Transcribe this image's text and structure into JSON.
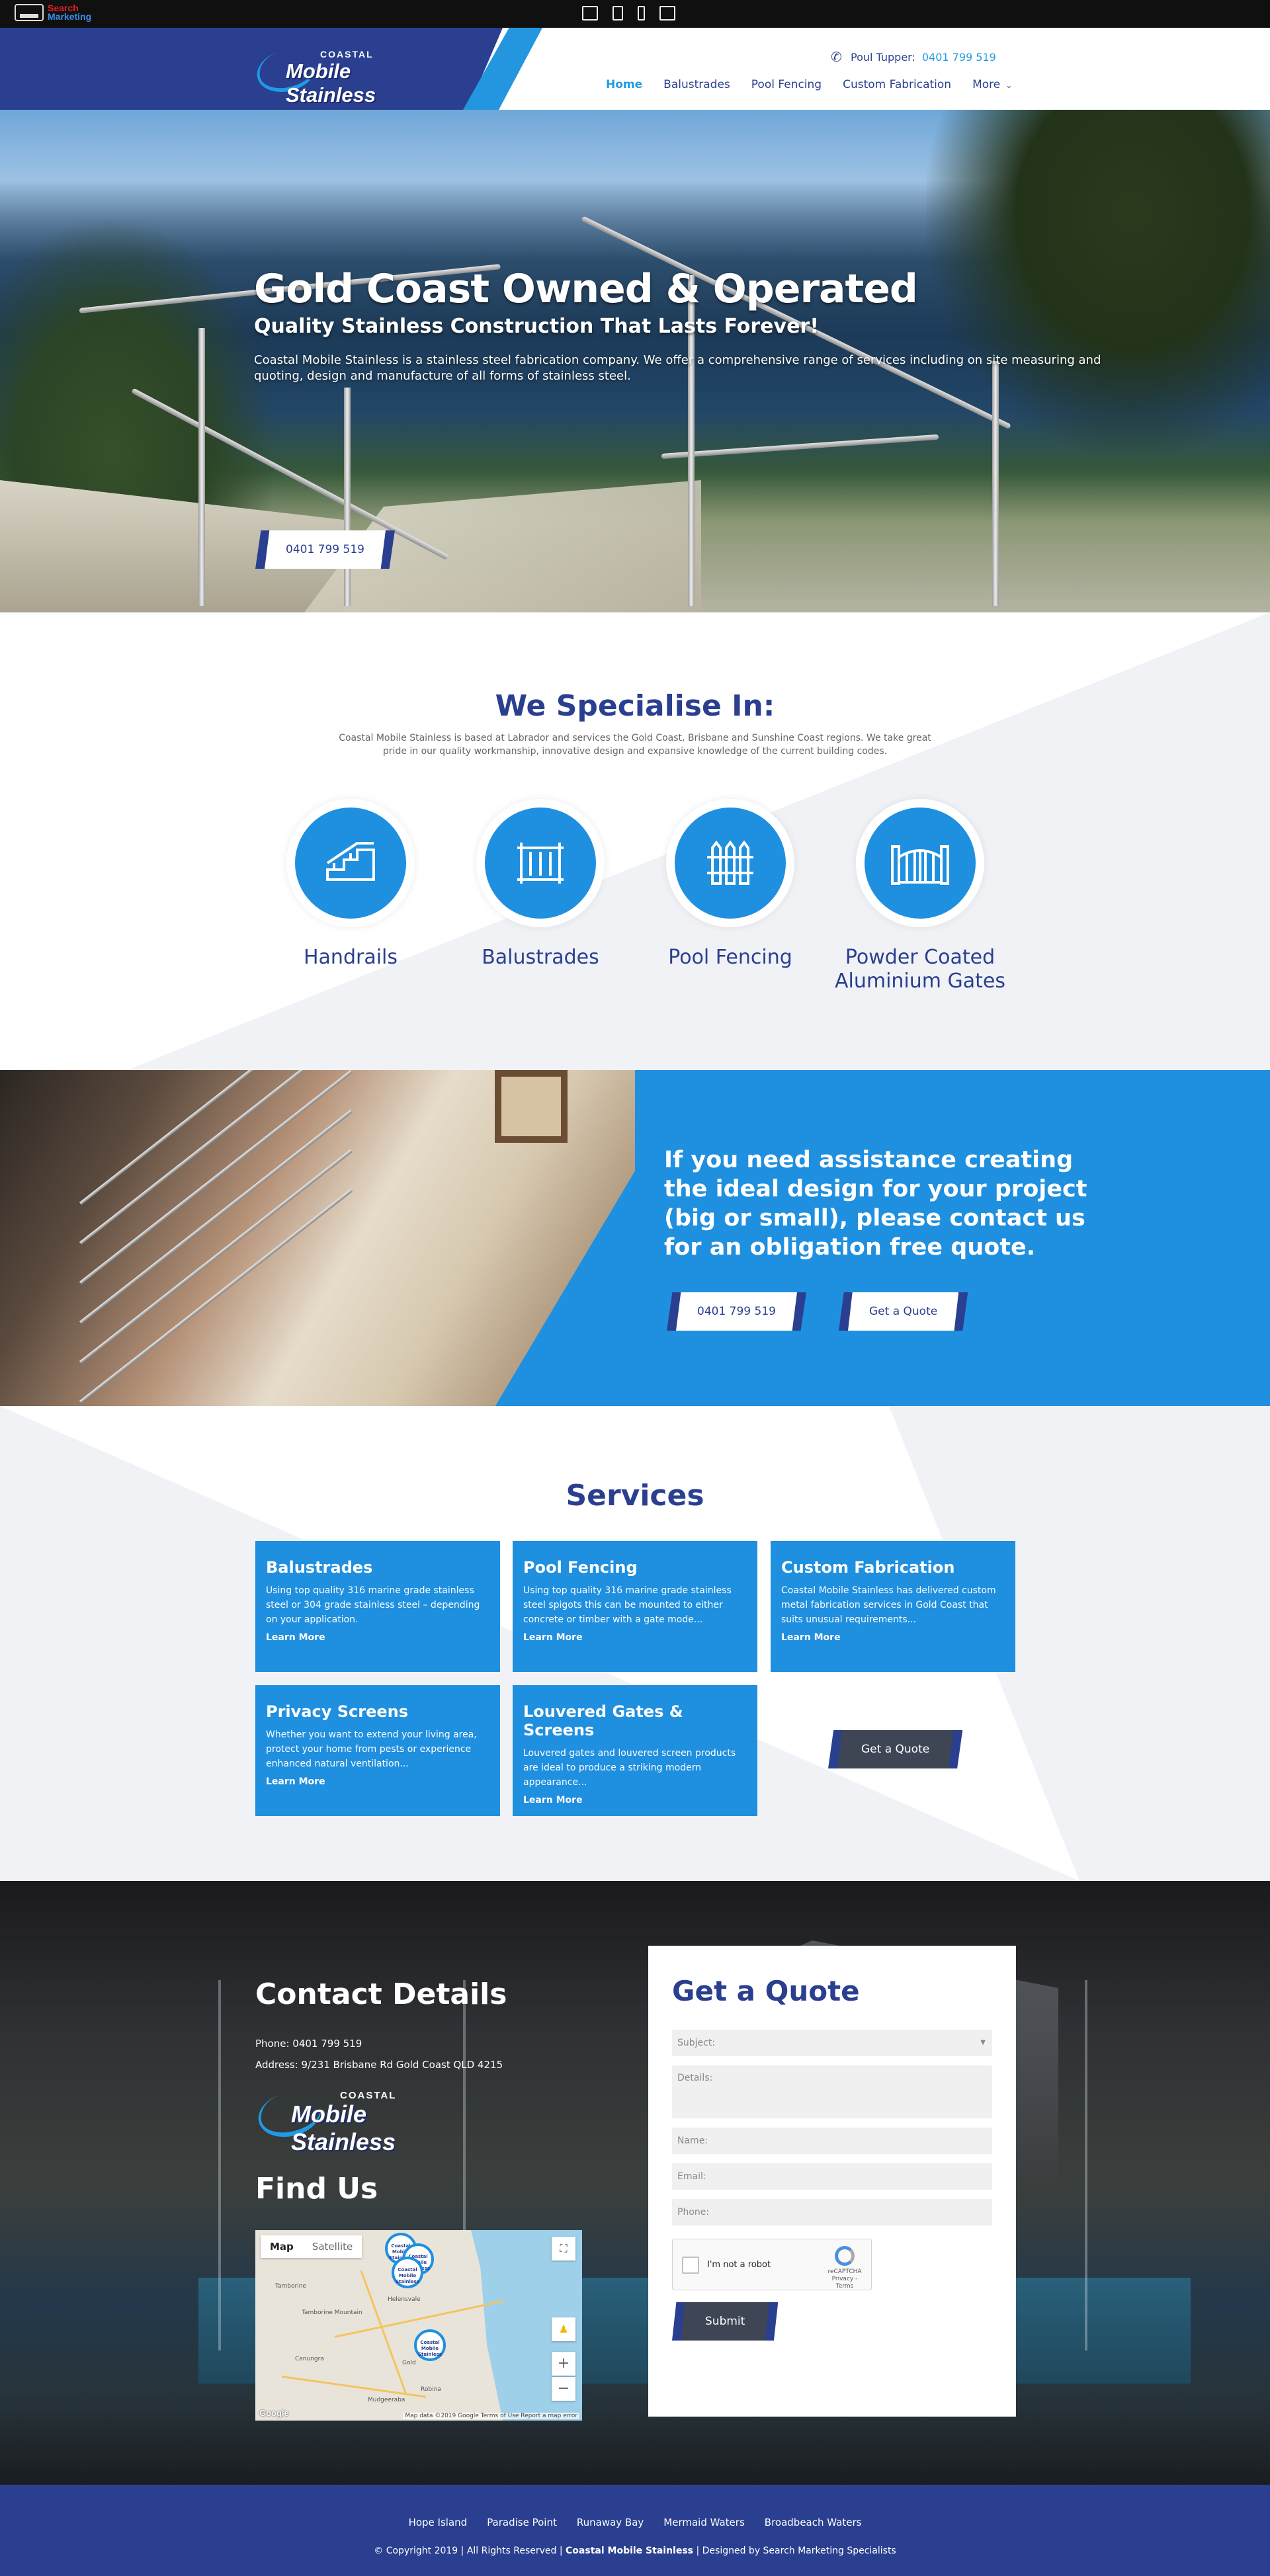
{
  "toolbar": {
    "brand_line1": "Search",
    "brand_line2": "Marketing",
    "devices": [
      "desktop-icon",
      "tablet-icon",
      "phone-icon",
      "responsive-icon"
    ]
  },
  "header": {
    "logo_top": "COASTAL",
    "logo_main": "Mobile Stainless",
    "phone_label": "Poul Tupper:",
    "phone_number": "0401 799 519",
    "nav": [
      {
        "label": "Home",
        "active": true
      },
      {
        "label": "Balustrades"
      },
      {
        "label": "Pool Fencing"
      },
      {
        "label": "Custom Fabrication"
      },
      {
        "label": "More"
      }
    ]
  },
  "hero": {
    "title": "Gold Coast Owned & Operated",
    "subtitle": "Quality Stainless Construction That Lasts Forever!",
    "body": "Coastal Mobile Stainless is a stainless steel fabrication company. We offer a comprehensive range of services including on site measuring and quoting, design and manufacture of all forms of stainless steel.",
    "button": "0401 799 519"
  },
  "specialise": {
    "title": "We Specialise In:",
    "body": "Coastal Mobile Stainless is based at Labrador and services the Gold Coast, Brisbane and Sunshine Coast regions. We take great pride in our quality workmanship, innovative design and expansive knowledge of the current building codes.",
    "items": [
      {
        "label": "Handrails",
        "icon": "handrail-icon"
      },
      {
        "label": "Balustrades",
        "icon": "balustrade-icon"
      },
      {
        "label": "Pool Fencing",
        "icon": "pool-fence-icon"
      },
      {
        "label": "Powder Coated Aluminium Gates",
        "icon": "gate-icon"
      }
    ]
  },
  "cta": {
    "text": "If you need assistance creating the ideal design for your project (big or small), please contact us for an obligation free quote.",
    "phone_button": "0401 799 519",
    "quote_button": "Get a Quote"
  },
  "services": {
    "title": "Services",
    "cards": [
      {
        "title": "Balustrades",
        "body": "Using top quality 316 marine grade stainless steel or 304 grade stainless steel – depending on your application.",
        "link": "Learn More"
      },
      {
        "title": "Pool Fencing",
        "body": "Using top quality 316 marine grade stainless steel spigots this can be mounted to either concrete or timber with a gate mode...",
        "link": "Learn More"
      },
      {
        "title": "Custom Fabrication",
        "body": "Coastal Mobile Stainless has delivered custom metal fabrication services in Gold Coast that suits unusual requirements...",
        "link": "Learn More"
      },
      {
        "title": "Privacy Screens",
        "body": "Whether you want to extend your living area, protect your home from pests or experience enhanced natural ventilation...",
        "link": "Learn More"
      },
      {
        "title": "Louvered Gates & Screens",
        "body": "Louvered gates and louvered screen products are ideal to produce a striking modern appearance...",
        "link": "Learn More"
      }
    ],
    "quote_button": "Get a Quote"
  },
  "contact": {
    "title": "Contact Details",
    "phone": "Phone: 0401 799 519",
    "address": "Address: 9/231 Brisbane Rd Gold Coast QLD 4215",
    "logo_top": "COASTAL",
    "logo_main": "Mobile Stainless",
    "find_us": "Find Us",
    "map": {
      "tab_map": "Map",
      "tab_satellite": "Satellite",
      "google": "Google",
      "attribution": "Map data ©2019 Google   Terms of Use   Report a map error",
      "pin_label": "Coastal Mobile Stainless",
      "towns": [
        "Tamborine",
        "Tamborine Mountain",
        "Canungra",
        "Helensvale",
        "Gold",
        "Robina",
        "Mudgeeraba"
      ]
    }
  },
  "quote_form": {
    "title": "Get a Quote",
    "subject": "Subject:",
    "details": "Details:",
    "name": "Name:",
    "email": "Email:",
    "phone": "Phone:",
    "captcha_label": "I'm not a robot",
    "captcha_brand": "reCAPTCHA",
    "captcha_links": "Privacy - Terms",
    "submit": "Submit"
  },
  "footer": {
    "links": [
      "Hope Island",
      "Paradise Point",
      "Runaway Bay",
      "Mermaid Waters",
      "Broadbeach Waters"
    ],
    "copy_prefix": "© Copyright 2019 | All Rights Reserved |",
    "copy_brand": "Coastal Mobile Stainless",
    "copy_suffix": "| Designed by Search Marketing Specialists"
  },
  "colors": {
    "navy": "#2a3f8f",
    "blue": "#1f8fe0",
    "footer": "#2a3f8f"
  }
}
